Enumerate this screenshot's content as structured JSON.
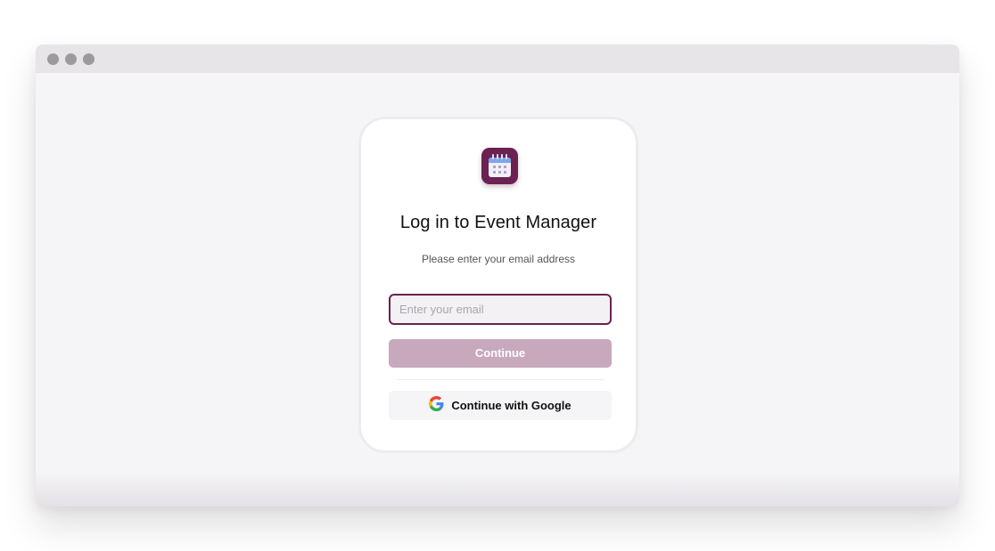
{
  "window": {
    "controls": [
      "close",
      "minimize",
      "maximize"
    ]
  },
  "login": {
    "logo_icon": "calendar-icon",
    "title": "Log in to Event Manager",
    "subtitle": "Please enter your email address",
    "email_placeholder": "Enter your email",
    "email_value": "",
    "continue_label": "Continue",
    "google_label": "Continue with Google",
    "google_icon": "google-icon"
  },
  "colors": {
    "brand": "#6b2152",
    "continue_disabled": "#c8a8bd",
    "card_bg": "#ffffff",
    "page_bg": "#f5f4f6"
  }
}
